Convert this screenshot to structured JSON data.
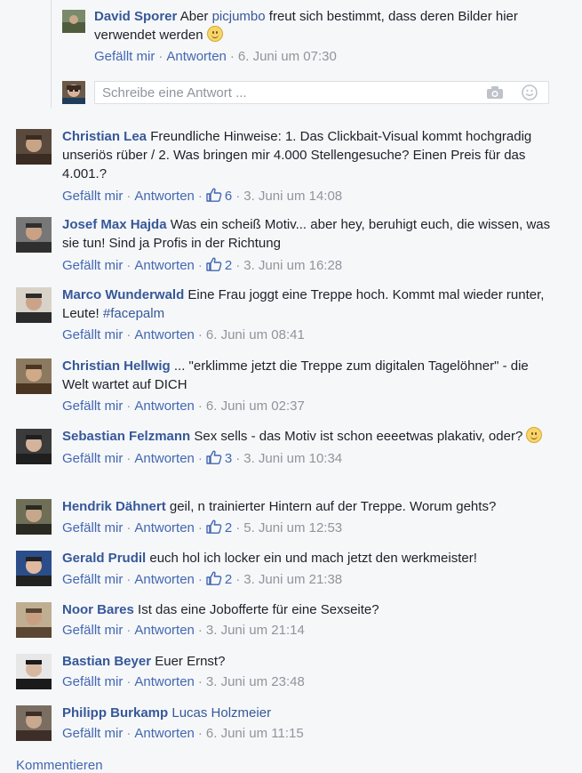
{
  "reply": {
    "author": "David Sporer",
    "text_before": "Aber",
    "mention": "picjumbo",
    "text_after": "freut sich bestimmt, dass deren Bilder hier verwendet werden",
    "like": "Gefällt mir",
    "answer": "Antworten",
    "time": "6. Juni um 07:30"
  },
  "reply_input": {
    "placeholder": "Schreibe eine Antwort ...",
    "camera_icon": "camera-icon",
    "emoji_icon": "smiley-icon"
  },
  "comments": [
    {
      "author": "Christian Lea",
      "text": "Freundliche Hinweise: 1. Das Clickbait-Visual kommt hochgradig unseriös rüber / 2. Was bringen mir 4.000 Stellengesuche? Einen Preis für das 4.001.?",
      "likes": "6",
      "time": "3. Juni um 14:08"
    },
    {
      "author": "Josef Max Hajda",
      "text": "Was ein scheiß Motiv... aber hey, beruhigt euch, die wissen, was sie tun! Sind ja Profis in der Richtung",
      "likes": "2",
      "time": "3. Juni um 16:28"
    },
    {
      "author": "Marco Wunderwald",
      "text": "Eine Frau joggt eine Treppe hoch. Kommt mal wieder runter, Leute!",
      "hashtag": "#facepalm",
      "likes": "",
      "time": "6. Juni um 08:41"
    },
    {
      "author": "Christian Hellwig",
      "text": "... \"erklimme jetzt die Treppe zum digitalen Tagelöhner\" - die Welt wartet auf DICH",
      "likes": "",
      "time": "6. Juni um 02:37"
    },
    {
      "author": "Sebastian Felzmann",
      "text": "Sex sells - das Motiv ist schon eeeetwas plakativ, oder?",
      "likes": "3",
      "time": "3. Juni um 10:34"
    },
    {
      "author": "Hendrik Dähnert",
      "text": "geil, n trainierter Hintern auf der Treppe. Worum gehts?",
      "likes": "2",
      "time": "5. Juni um 12:53"
    },
    {
      "author": "Gerald Prudil",
      "text": "euch hol ich locker ein und mach jetzt den werkmeister!",
      "likes": "2",
      "time": "3. Juni um 21:38"
    },
    {
      "author": "Noor Bares",
      "text": "Ist das eine Jobofferte für eine Sexseite?",
      "likes": "",
      "time": "3. Juni um 21:14"
    },
    {
      "author": "Bastian Beyer",
      "text": "Euer Ernst?",
      "likes": "",
      "time": "3. Juni um 23:48"
    },
    {
      "author": "Philipp Burkamp",
      "tag": "Lucas Holzmeier",
      "likes": "",
      "time": "6. Juni um 11:15"
    }
  ],
  "labels": {
    "like": "Gefällt mir",
    "answer": "Antworten",
    "dot": "·"
  },
  "footer": {
    "comment_link": "Kommentieren"
  }
}
